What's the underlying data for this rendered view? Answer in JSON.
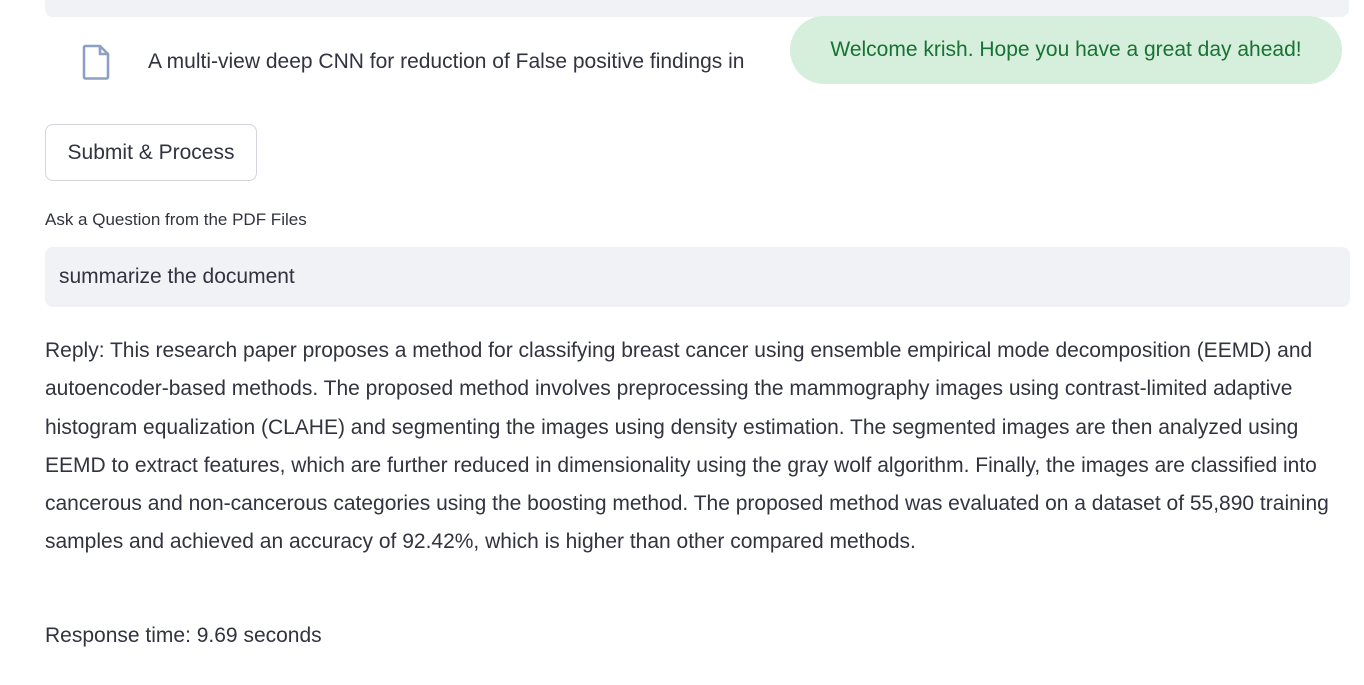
{
  "file": {
    "name": "A multi-view deep CNN for reduction of False positive findings in",
    "icon": "file-document-icon"
  },
  "toast": {
    "message": "Welcome krish. Hope you have a great day ahead!"
  },
  "actions": {
    "submit_label": "Submit & Process"
  },
  "question": {
    "label": "Ask a Question from the PDF Files",
    "value": "summarize the document"
  },
  "reply": {
    "text": "Reply: This research paper proposes a method for classifying breast cancer using ensemble empirical mode decomposition (EEMD) and autoencoder-based methods. The proposed method involves preprocessing the mammography images using contrast-limited adaptive histogram equalization (CLAHE) and segmenting the images using density estimation. The segmented images are then analyzed using EEMD to extract features, which are further reduced in dimensionality using the gray wolf algorithm. Finally, the images are classified into cancerous and non-cancerous categories using the boosting method. The proposed method was evaluated on a dataset of 55,890 training samples and achieved an accuracy of 92.42%, which is higher than other compared methods."
  },
  "response": {
    "time_text": "Response time: 9.69 seconds"
  },
  "colors": {
    "toast_bg": "#d6eedc",
    "toast_text": "#177233",
    "input_bg": "#f0f2f6",
    "icon": "#8e9fc4",
    "text": "#31333f"
  }
}
